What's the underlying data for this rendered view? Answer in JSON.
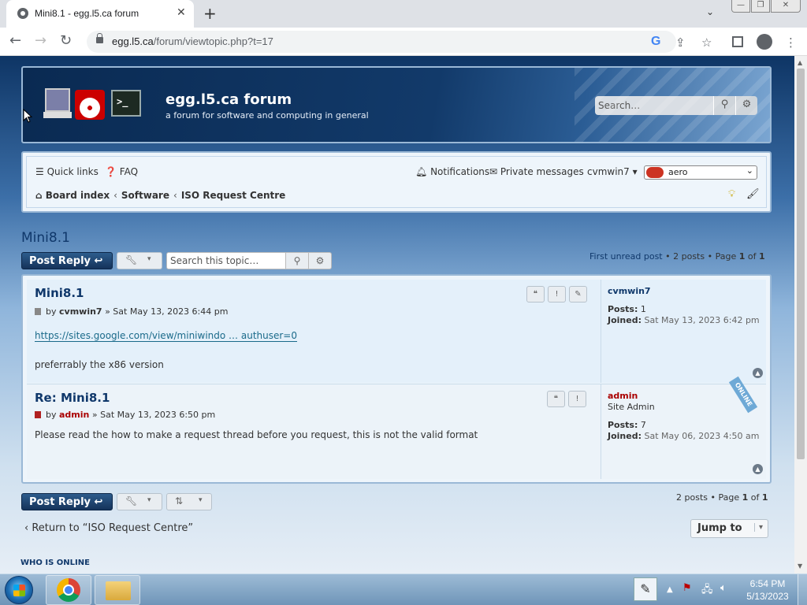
{
  "browser": {
    "tab_title": "Mini8.1 - egg.l5.ca forum",
    "tab_close": "✕",
    "new_tab": "+",
    "url_host": "egg.l5.ca",
    "url_path": "/forum/viewtopic.php?t=17",
    "window_buttons": {
      "minimize": "—",
      "maximize": "❐",
      "close": "✕"
    }
  },
  "header": {
    "site_title": "egg.l5.ca forum",
    "site_description": "a forum for software and computing in general",
    "search_placeholder": "Search…"
  },
  "navbar": {
    "quick_links": "Quick links",
    "faq": "FAQ",
    "notifications": "Notifications",
    "private_messages": "Private messages",
    "username": "cvmwin7",
    "style_value": "aero",
    "breadcrumb": [
      "Board index",
      "Software",
      "ISO Request Centre"
    ]
  },
  "topic": {
    "title": "Mini8.1",
    "post_reply": "Post Reply",
    "search_placeholder": "Search this topic…",
    "pagination_top": {
      "first_unread": "First unread post",
      "posts_count": "2 posts",
      "page_label": "Page",
      "current_page": "1",
      "of": "of",
      "total_pages": "1"
    },
    "pagination_bottom": {
      "posts_count": "2 posts",
      "page_label": "Page",
      "current_page": "1",
      "of": "of",
      "total_pages": "1"
    },
    "return_link": "Return to “ISO Request Centre”",
    "jump_to": "Jump to",
    "who_is_online": "WHO IS ONLINE"
  },
  "posts": [
    {
      "title": "Mini8.1",
      "by": "by",
      "author": "cvmwin7",
      "date": "» Sat May 13, 2023 6:44 pm",
      "link": "https://sites.google.com/view/miniwindo … authuser=0",
      "body": "preferrably the x86 version",
      "profile": {
        "username": "cvmwin7",
        "rank": "",
        "posts_label": "Posts:",
        "posts": "1",
        "joined_label": "Joined:",
        "joined": "Sat May 13, 2023 6:42 pm"
      }
    },
    {
      "title": "Re: Mini8.1",
      "by": "by",
      "author": "admin",
      "date": "» Sat May 13, 2023 6:50 pm",
      "body": "Please read the how to make a request thread before you request, this is not the valid format",
      "profile": {
        "username": "admin",
        "rank": "Site Admin",
        "posts_label": "Posts:",
        "posts": "7",
        "joined_label": "Joined:",
        "joined": "Sat May 06, 2023 4:50 am",
        "online_badge": "ONLINE"
      }
    }
  ],
  "taskbar": {
    "time": "6:54 PM",
    "date": "5/13/2023"
  }
}
